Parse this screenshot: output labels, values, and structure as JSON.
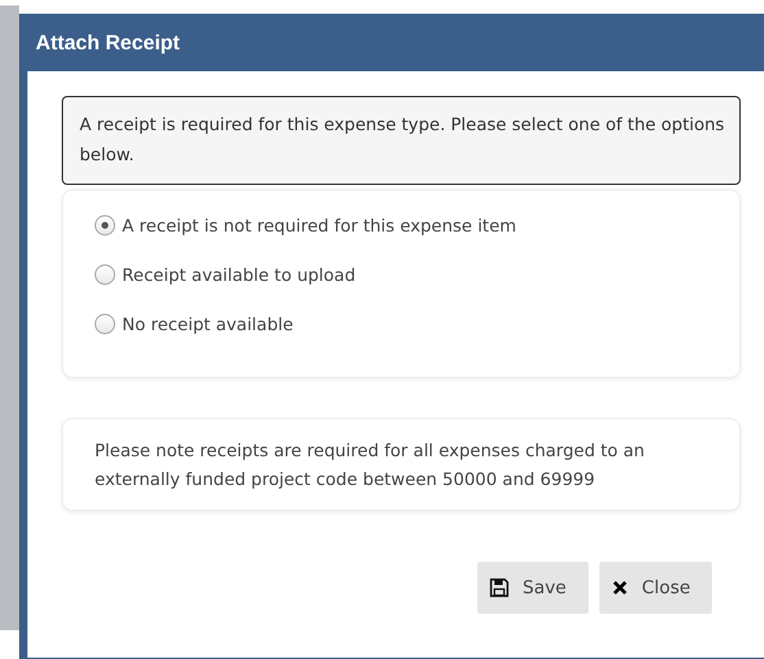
{
  "dialog": {
    "title": "Attach Receipt",
    "notice": "A receipt is required for this expense type. Please select one of the options below.",
    "options": [
      {
        "label": "A receipt is not required for this expense item",
        "selected": true
      },
      {
        "label": "Receipt available to upload",
        "selected": false
      },
      {
        "label": "No receipt available",
        "selected": false
      }
    ],
    "note": "Please note receipts are required for all expenses charged to an externally funded project code between 50000 and 69999",
    "buttons": [
      {
        "label": "Save",
        "kind": "save"
      },
      {
        "label": "Close",
        "kind": "close"
      }
    ]
  }
}
